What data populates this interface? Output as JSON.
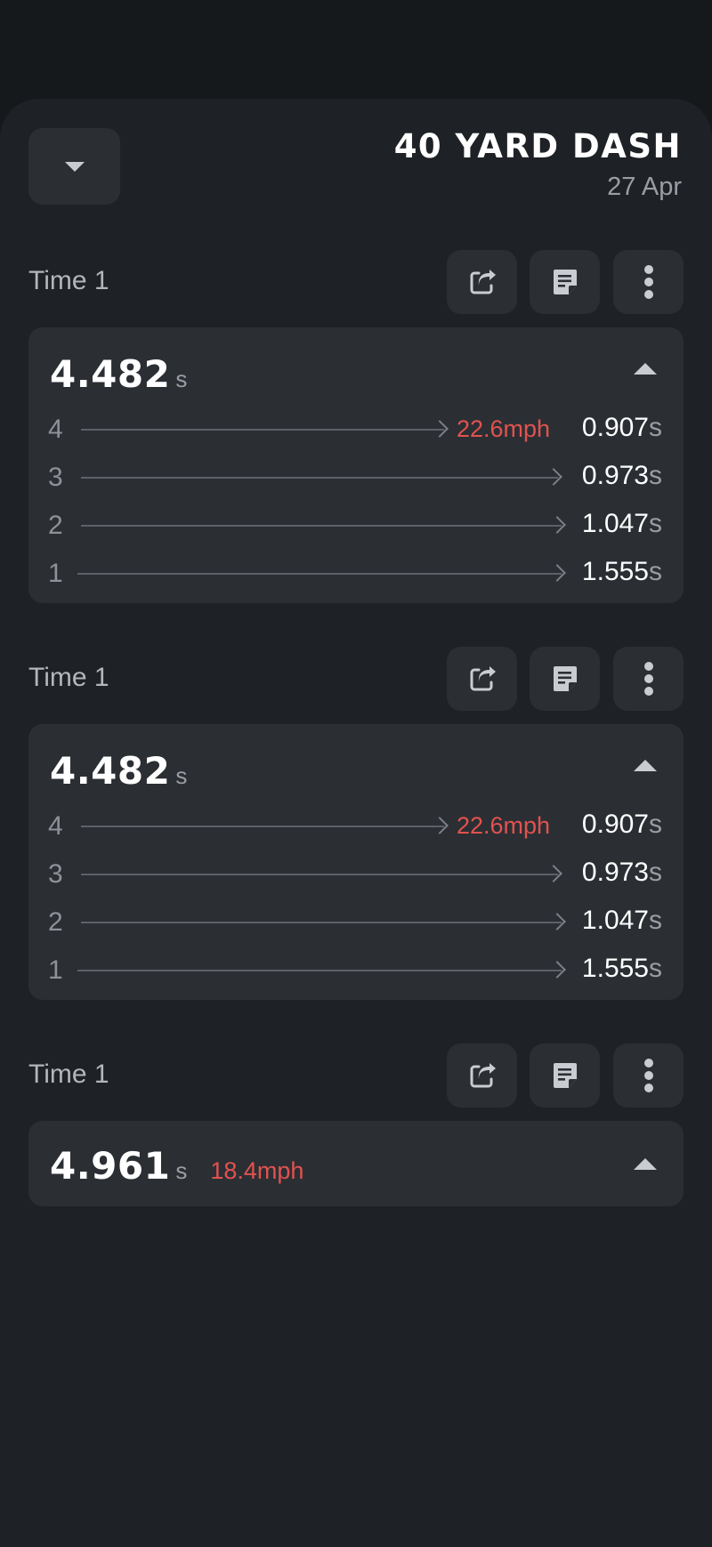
{
  "header": {
    "title": "40 YARD DASH",
    "date": "27 Apr"
  },
  "trials": [
    {
      "label": "Time 1",
      "total": "4.482",
      "unit": "s",
      "splits": [
        {
          "num": "4",
          "speed": "22.6mph",
          "time": "0.907",
          "unit": "s"
        },
        {
          "num": "3",
          "time": "0.973",
          "unit": "s"
        },
        {
          "num": "2",
          "time": "1.047",
          "unit": "s"
        },
        {
          "num": "1",
          "time": "1.555",
          "unit": "s"
        }
      ]
    },
    {
      "label": "Time 1",
      "total": "4.482",
      "unit": "s",
      "splits": [
        {
          "num": "4",
          "speed": "22.6mph",
          "time": "0.907",
          "unit": "s"
        },
        {
          "num": "3",
          "time": "0.973",
          "unit": "s"
        },
        {
          "num": "2",
          "time": "1.047",
          "unit": "s"
        },
        {
          "num": "1",
          "time": "1.555",
          "unit": "s"
        }
      ]
    },
    {
      "label": "Time 1",
      "total": "4.961",
      "unit": "s",
      "speed": "18.4mph"
    }
  ],
  "icons": {
    "collapse": "caret-down-icon",
    "share": "share-icon",
    "note": "note-icon",
    "more": "more-vertical-icon",
    "expand": "caret-up-icon"
  },
  "colors": {
    "background": "#16191c",
    "sheet": "#1e2125",
    "card": "#2b2f34",
    "accent_speed": "#e2524f"
  }
}
